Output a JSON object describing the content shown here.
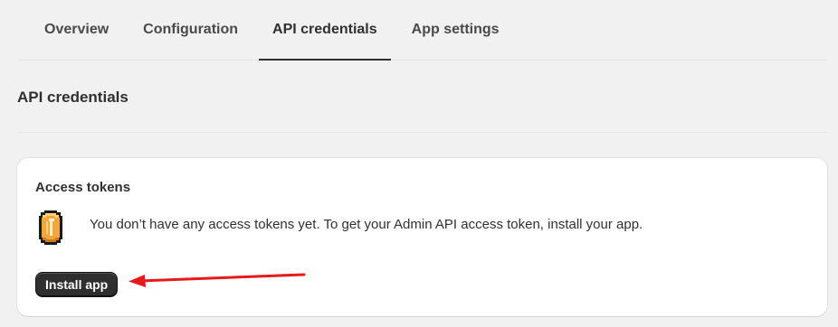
{
  "tabs": [
    {
      "label": "Overview",
      "active": false
    },
    {
      "label": "Configuration",
      "active": false
    },
    {
      "label": "API credentials",
      "active": true
    },
    {
      "label": "App settings",
      "active": false
    }
  ],
  "section": {
    "title": "API credentials"
  },
  "access_tokens_card": {
    "title": "Access tokens",
    "icon": "token-coin-icon",
    "message": "You don’t have any access tokens yet. To get your Admin API access token, install your app.",
    "install_button_label": "Install app"
  },
  "annotation": {
    "arrow_color": "#e8191a",
    "points_to": "install-app-button"
  },
  "colors": {
    "background": "#f1f1f1",
    "card": "#ffffff",
    "primary_button": "#2f2f2f",
    "coin": "#f2a63c"
  }
}
